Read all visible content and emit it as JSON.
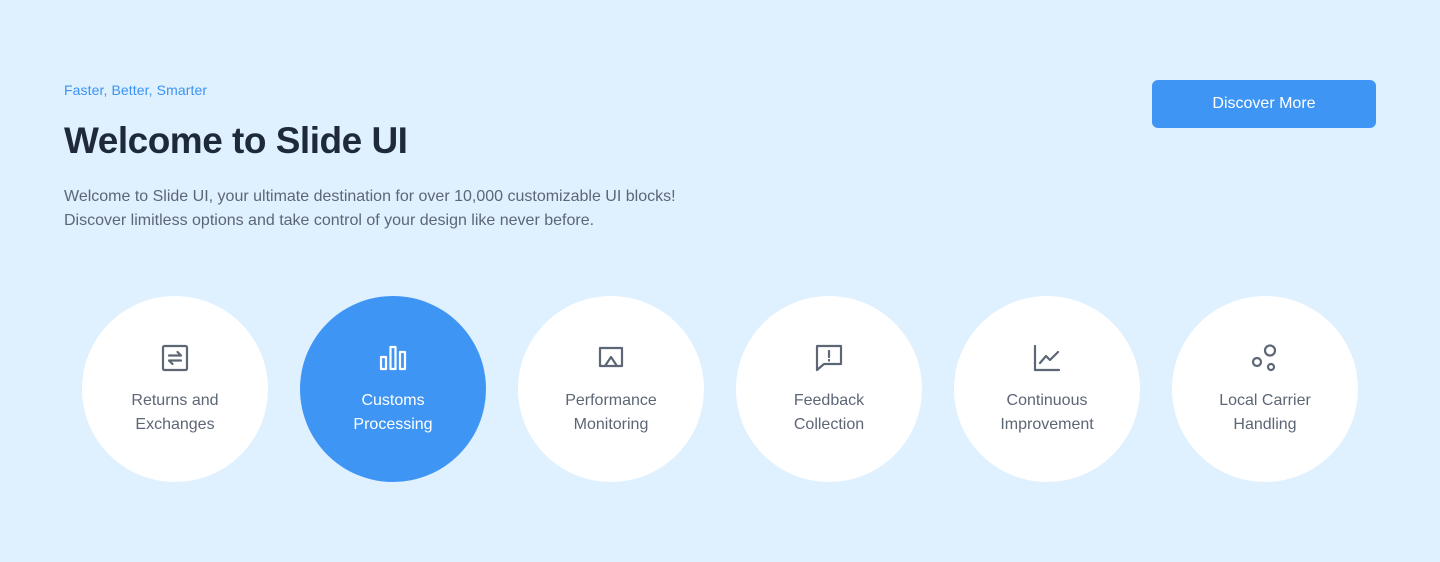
{
  "hero": {
    "eyebrow": "Faster, Better, Smarter",
    "title": "Welcome to Slide UI",
    "description": "Welcome to Slide UI, your ultimate destination for over 10,000 customizable UI blocks! Discover limitless options and take control of your design like never before.",
    "cta_label": "Discover More"
  },
  "features": [
    {
      "line1": "Returns and",
      "line2": "Exchanges",
      "icon": "exchange-icon",
      "active": false
    },
    {
      "line1": "Customs",
      "line2": "Processing",
      "icon": "bar-chart-icon",
      "active": true
    },
    {
      "line1": "Performance",
      "line2": "Monitoring",
      "icon": "screen-share-icon",
      "active": false
    },
    {
      "line1": "Feedback",
      "line2": "Collection",
      "icon": "feedback-icon",
      "active": false
    },
    {
      "line1": "Continuous",
      "line2": "Improvement",
      "icon": "line-chart-icon",
      "active": false
    },
    {
      "line1": "Local Carrier",
      "line2": "Handling",
      "icon": "bubbles-icon",
      "active": false
    }
  ],
  "colors": {
    "background": "#dff0ff",
    "accent": "#3e95f4",
    "heading": "#1e2a3b",
    "body_text": "#5d6675",
    "eyebrow": "#3b94f3"
  }
}
